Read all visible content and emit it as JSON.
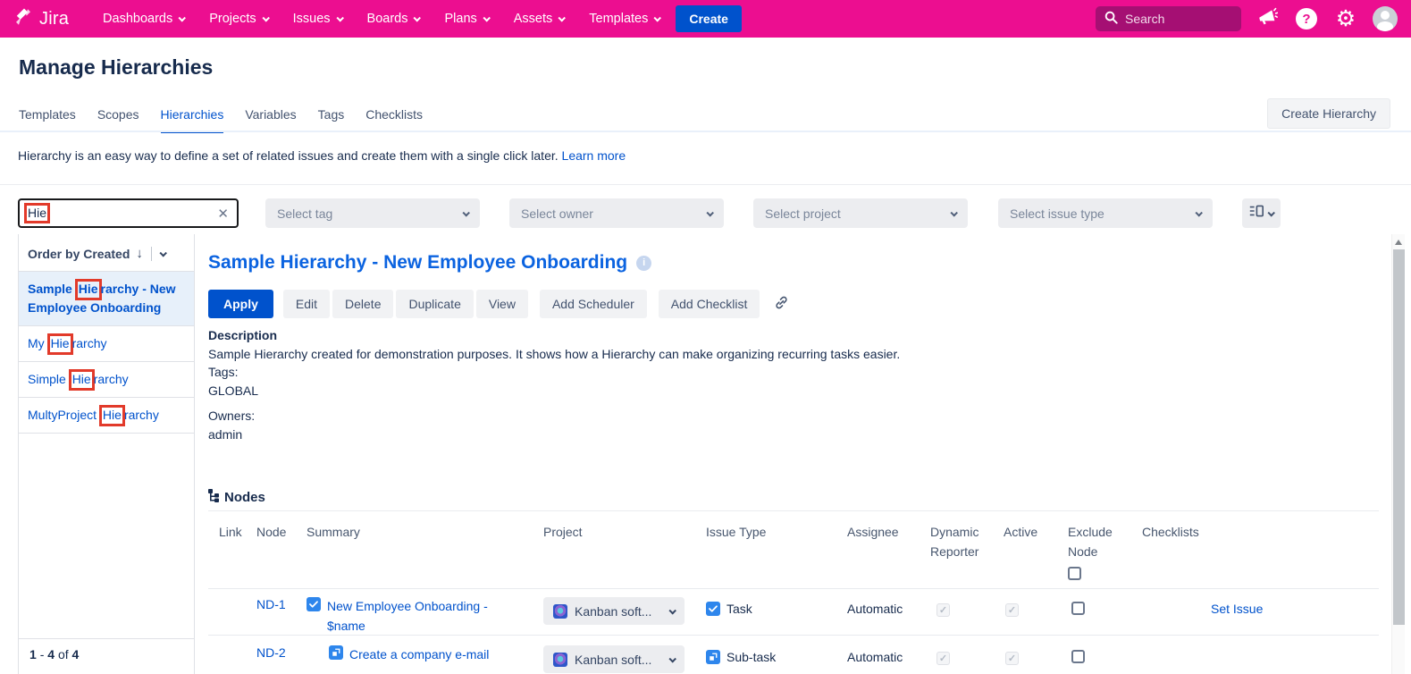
{
  "top_nav": {
    "brand": "Jira",
    "menu": [
      "Dashboards",
      "Projects",
      "Issues",
      "Boards",
      "Plans",
      "Assets",
      "Templates"
    ],
    "create_label": "Create",
    "search_placeholder": "Search"
  },
  "page": {
    "title": "Manage Hierarchies",
    "tabs": [
      "Templates",
      "Scopes",
      "Hierarchies",
      "Variables",
      "Tags",
      "Checklists"
    ],
    "active_tab": "Hierarchies",
    "create_hierarchy_label": "Create Hierarchy",
    "intro_text": "Hierarchy is an easy way to define a set of related issues and create them with a single click later.",
    "intro_link": "Learn more"
  },
  "filters": {
    "search_value": "Hie",
    "tag_placeholder": "Select tag",
    "owner_placeholder": "Select owner",
    "project_placeholder": "Select project",
    "issue_type_placeholder": "Select issue type"
  },
  "sidebar": {
    "order_label": "Order by Created",
    "items": [
      {
        "prefix": "Sample ",
        "match": "Hie",
        "suffix": "rarchy - New Employee Onboarding",
        "selected": true
      },
      {
        "prefix": "My ",
        "match": "Hie",
        "suffix": "rarchy",
        "selected": false
      },
      {
        "prefix": "Simple ",
        "match": "Hie",
        "suffix": "rarchy",
        "selected": false
      },
      {
        "prefix": "MultyProject ",
        "match": "Hie",
        "suffix": "rarchy",
        "selected": false
      }
    ],
    "pagination": {
      "range_start": "1",
      "dash": "-",
      "range_end": "4",
      "of_label": "of",
      "total": "4"
    }
  },
  "detail": {
    "title": "Sample Hierarchy - New Employee Onboarding",
    "actions": {
      "apply": "Apply",
      "edit": "Edit",
      "delete": "Delete",
      "duplicate": "Duplicate",
      "view": "View",
      "add_scheduler": "Add Scheduler",
      "add_checklist": "Add Checklist"
    },
    "description_label": "Description",
    "description_text": "Sample Hierarchy created for demonstration purposes. It shows how a Hierarchy can make organizing recurring tasks easier.",
    "tags_label": "Tags:",
    "tags_value": "GLOBAL",
    "owners_label": "Owners:",
    "owners_value": "admin",
    "nodes_title": "Nodes"
  },
  "table": {
    "headers": {
      "link": "Link",
      "node": "Node",
      "summary": "Summary",
      "project": "Project",
      "issue_type": "Issue Type",
      "assignee": "Assignee",
      "dynamic_reporter": "Dynamic Reporter",
      "active": "Active",
      "exclude_node": "Exclude Node",
      "checklists": "Checklists"
    },
    "rows": [
      {
        "node": "ND-1",
        "summary": "New Employee Onboarding - $name",
        "project": "Kanban soft...",
        "issue_type": "Task",
        "assignee": "Automatic",
        "dynamic_reporter_checked": true,
        "active_checked": true,
        "exclude_checked": false,
        "checklist_link": "Set Issue"
      },
      {
        "node": "ND-2",
        "summary": "Create a company e-mail",
        "project": "Kanban soft...",
        "issue_type": "Sub-task",
        "assignee": "Automatic",
        "dynamic_reporter_checked": true,
        "active_checked": true,
        "exclude_checked": false,
        "checklist_link": ""
      }
    ]
  },
  "icons": {
    "clear": "✕",
    "sort_desc": "↓",
    "gear": "⚙"
  },
  "colors": {
    "nav_pink": "#EC0E90",
    "primary_blue": "#0052CC",
    "title_blue": "#0B63E0",
    "text_dark": "#172B4D",
    "annotation_red": "#E23A2A",
    "issue_icon_blue": "#2E86EC"
  }
}
